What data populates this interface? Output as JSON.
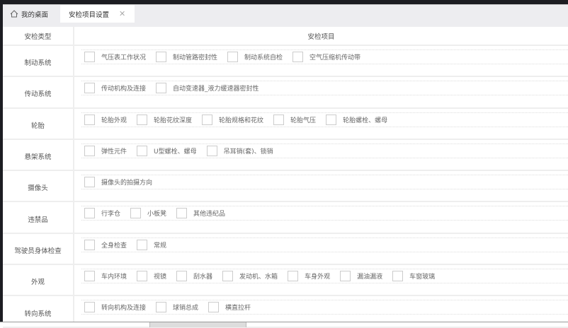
{
  "tabs": [
    {
      "label": "我的桌面"
    },
    {
      "label": "安检项目设置",
      "close": "✕"
    }
  ],
  "header": {
    "type_col": "安检类型",
    "items_col": "安检项目"
  },
  "rows": [
    {
      "type": "制动系统",
      "items": [
        "气压表工作状况",
        "制动管路密封性",
        "制动系统自检",
        "空气压缩机传动带"
      ]
    },
    {
      "type": "传动系统",
      "items": [
        "传动机构及连接",
        "自动变速器_液力缓速器密封性"
      ]
    },
    {
      "type": "轮胎",
      "items": [
        "轮胎外观",
        "轮胎花纹深度",
        "轮胎规格和花纹",
        "轮胎气压",
        "轮胎螺栓、螺母"
      ]
    },
    {
      "type": "悬架系统",
      "items": [
        "弹性元件",
        "U型螺栓、螺母",
        "吊耳销(套)、锁销"
      ]
    },
    {
      "type": "摄像头",
      "items": [
        "摄像头的拍摄方向"
      ]
    },
    {
      "type": "违禁品",
      "items": [
        "行李仓",
        "小板凳",
        "其他违纪品"
      ]
    },
    {
      "type": "驾驶员身体检查",
      "items": [
        "全身检查",
        "常规"
      ]
    },
    {
      "type": "外观",
      "items": [
        "车内环境",
        "视镜",
        "刮水器",
        "发动机、水箱",
        "车身外观",
        "漏油漏液",
        "车窗玻璃"
      ]
    },
    {
      "type": "转向系统",
      "items": [
        "转向机构及连接",
        "球销总成",
        "横直拉杆"
      ]
    }
  ]
}
